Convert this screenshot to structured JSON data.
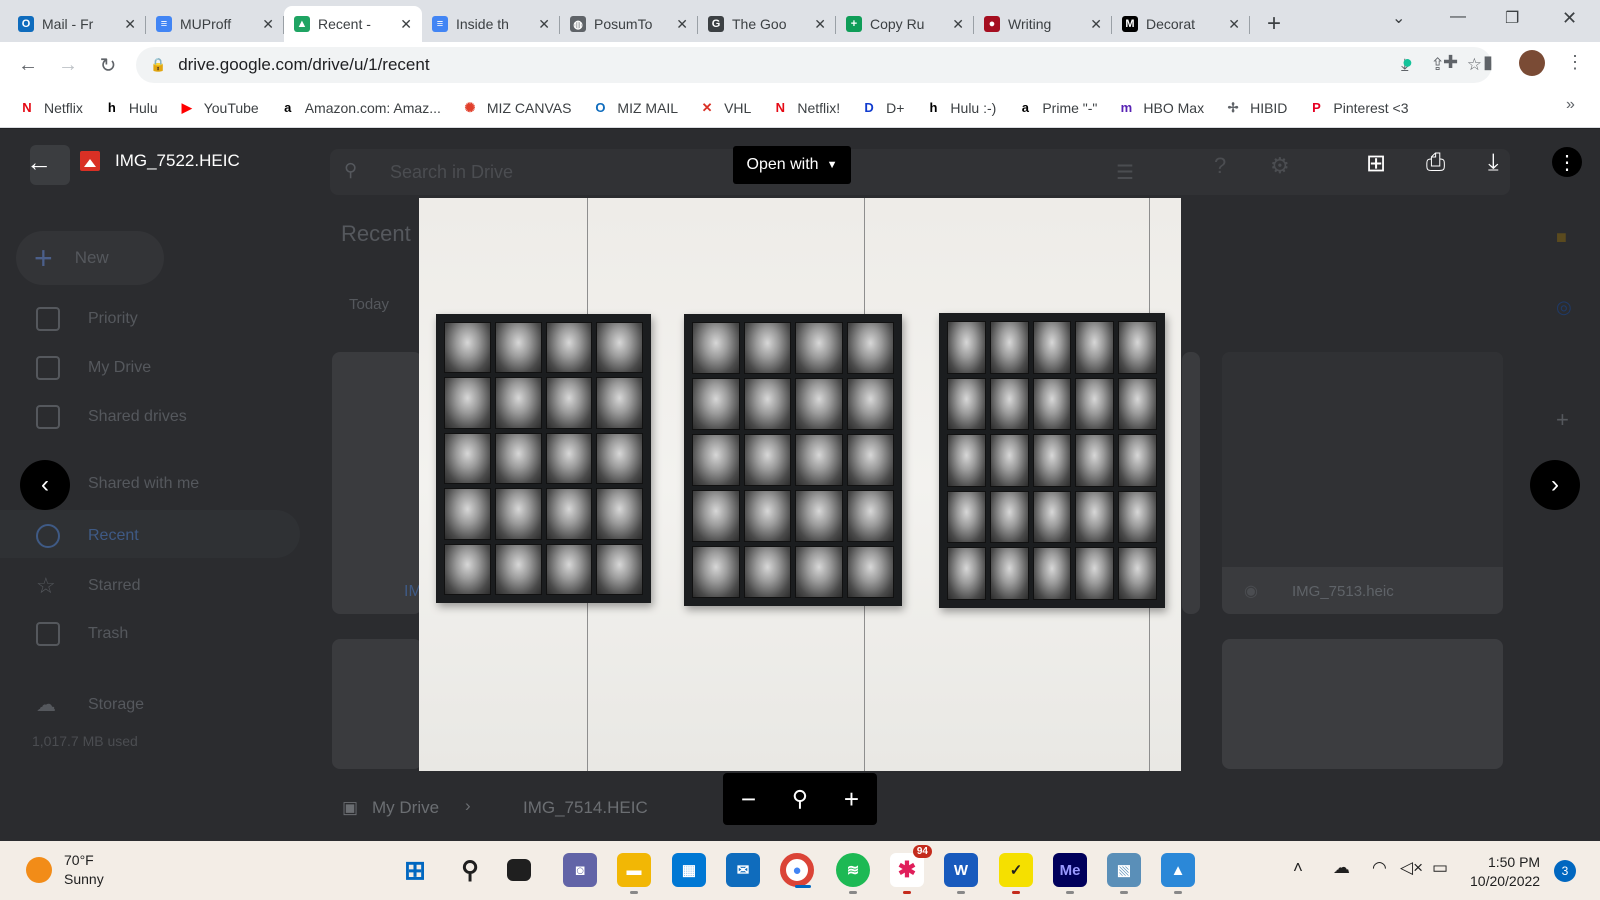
{
  "browser": {
    "tabs": [
      {
        "title": "Mail - Fr",
        "favicon": "outlook-icon",
        "color": "#0f6cbd",
        "glyph": "O"
      },
      {
        "title": "MUProff",
        "favicon": "docs-icon",
        "color": "#4285f4",
        "glyph": "≡"
      },
      {
        "title": "Recent -",
        "favicon": "drive-icon",
        "color": "#1fa463",
        "glyph": "▲",
        "active": true
      },
      {
        "title": "Inside th",
        "favicon": "docs-icon",
        "color": "#4285f4",
        "glyph": "≡"
      },
      {
        "title": "PosumTo",
        "favicon": "globe-icon",
        "color": "#5f6368",
        "glyph": "◍"
      },
      {
        "title": "The Goo",
        "favicon": "google-icon",
        "color": "#3c4043",
        "glyph": "G"
      },
      {
        "title": "Copy Ru",
        "favicon": "sheets-icon",
        "color": "#0f9d58",
        "glyph": "+"
      },
      {
        "title": "Writing",
        "favicon": "circle-icon",
        "color": "#a50e20",
        "glyph": "●"
      },
      {
        "title": "Decorat",
        "favicon": "mizzou-icon",
        "color": "#000000",
        "glyph": "M"
      }
    ],
    "url": "drive.google.com/drive/u/1/recent",
    "bookmarks": [
      {
        "label": "Netflix",
        "icon": "netflix-icon",
        "color": "#e50914",
        "glyph": "N"
      },
      {
        "label": "Hulu",
        "icon": "hulu-icon",
        "color": "#000000",
        "glyph": "h"
      },
      {
        "label": "YouTube",
        "icon": "youtube-icon",
        "color": "#ff0000",
        "glyph": "▶"
      },
      {
        "label": "Amazon.com: Amaz...",
        "icon": "amazon-icon",
        "color": "#000000",
        "glyph": "a"
      },
      {
        "label": "MIZ CANVAS",
        "icon": "canvas-icon",
        "color": "#e13f2b",
        "glyph": "✺"
      },
      {
        "label": "MIZ MAIL",
        "icon": "outlook-icon",
        "color": "#0f6cbd",
        "glyph": "O"
      },
      {
        "label": "VHL",
        "icon": "vhl-icon",
        "color": "#d93025",
        "glyph": "✕"
      },
      {
        "label": "Netflix!",
        "icon": "netflix-icon",
        "color": "#e50914",
        "glyph": "N"
      },
      {
        "label": "D+",
        "icon": "disney-icon",
        "color": "#113ccf",
        "glyph": "D"
      },
      {
        "label": "Hulu :-)",
        "icon": "hulu-icon",
        "color": "#000000",
        "glyph": "h"
      },
      {
        "label": "Prime \"-\"",
        "icon": "amazon-icon",
        "color": "#000000",
        "glyph": "a"
      },
      {
        "label": "HBO Max",
        "icon": "hbomax-icon",
        "color": "#5822b4",
        "glyph": "m"
      },
      {
        "label": "HIBID",
        "icon": "hibid-icon",
        "color": "#5f6368",
        "glyph": "✢"
      },
      {
        "label": "Pinterest <3",
        "icon": "pinterest-icon",
        "color": "#e60023",
        "glyph": "P"
      }
    ]
  },
  "drive": {
    "search_placeholder": "Search in Drive",
    "new_label": "New",
    "section_title": "Recent",
    "today_label": "Today",
    "nav": [
      {
        "label": "Priority"
      },
      {
        "label": "My Drive"
      },
      {
        "label": "Shared drives"
      },
      {
        "label": "Shared with me"
      },
      {
        "label": "Recent"
      },
      {
        "label": "Starred"
      },
      {
        "label": "Trash"
      },
      {
        "label": "Storage"
      }
    ],
    "storage_used": "1,017.7 MB used",
    "file_card_label": "IMG_7513.heic",
    "partial_card_label": "IM",
    "breadcrumb": {
      "root": "My Drive",
      "file": "IMG_7514.HEIC"
    }
  },
  "viewer": {
    "file_name": "IMG_7522.HEIC",
    "open_with_label": "Open with"
  },
  "taskbar": {
    "temperature": "70°F",
    "condition": "Sunny",
    "time": "1:50 PM",
    "date": "10/20/2022",
    "notifications": "3",
    "slack_badge": "94"
  }
}
